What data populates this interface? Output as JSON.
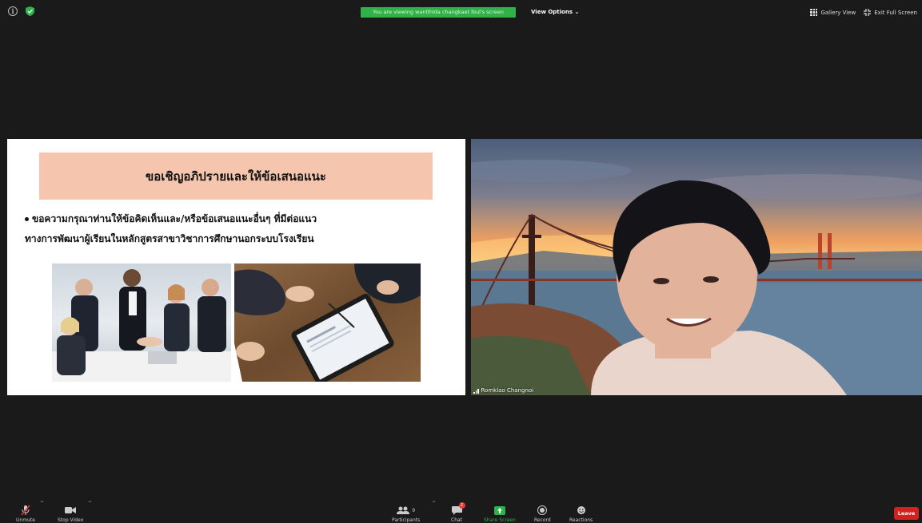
{
  "top_bar": {
    "viewing_banner": "You are viewing wanlthlda changkaet lbul's screen",
    "view_options_label": "View Options",
    "gallery_view_label": "Gallery View",
    "exit_full_screen_label": "Exit Full Screen"
  },
  "slide": {
    "title": "ขอเชิญอภิปรายและให้ข้อเสนอแนะ",
    "bullet_line1": "ขอความกรุณาท่านให้ข้อคิดเห็นและ/หรือข้อเสนอแนะอื่นๆ ที่มีต่อแนว",
    "bullet_line2": "ทางการพัฒนาผู้เรียนในหลักสูตรสาขาวิชาการศึกษานอกระบบโรงเรียน"
  },
  "video": {
    "participant_name": "Romklao Changnoi"
  },
  "toolbar": {
    "unmute_label": "Unmute",
    "stop_video_label": "Stop Video",
    "participants_label": "Participants",
    "participants_count": "9",
    "chat_label": "Chat",
    "chat_badge": "2",
    "share_screen_label": "Share Screen",
    "record_label": "Record",
    "reactions_label": "Reactions",
    "leave_label": "Leave"
  },
  "colors": {
    "share_green": "#2fb24c",
    "leave_red": "#d4201f",
    "title_bar_peach": "#f5c6ad"
  }
}
